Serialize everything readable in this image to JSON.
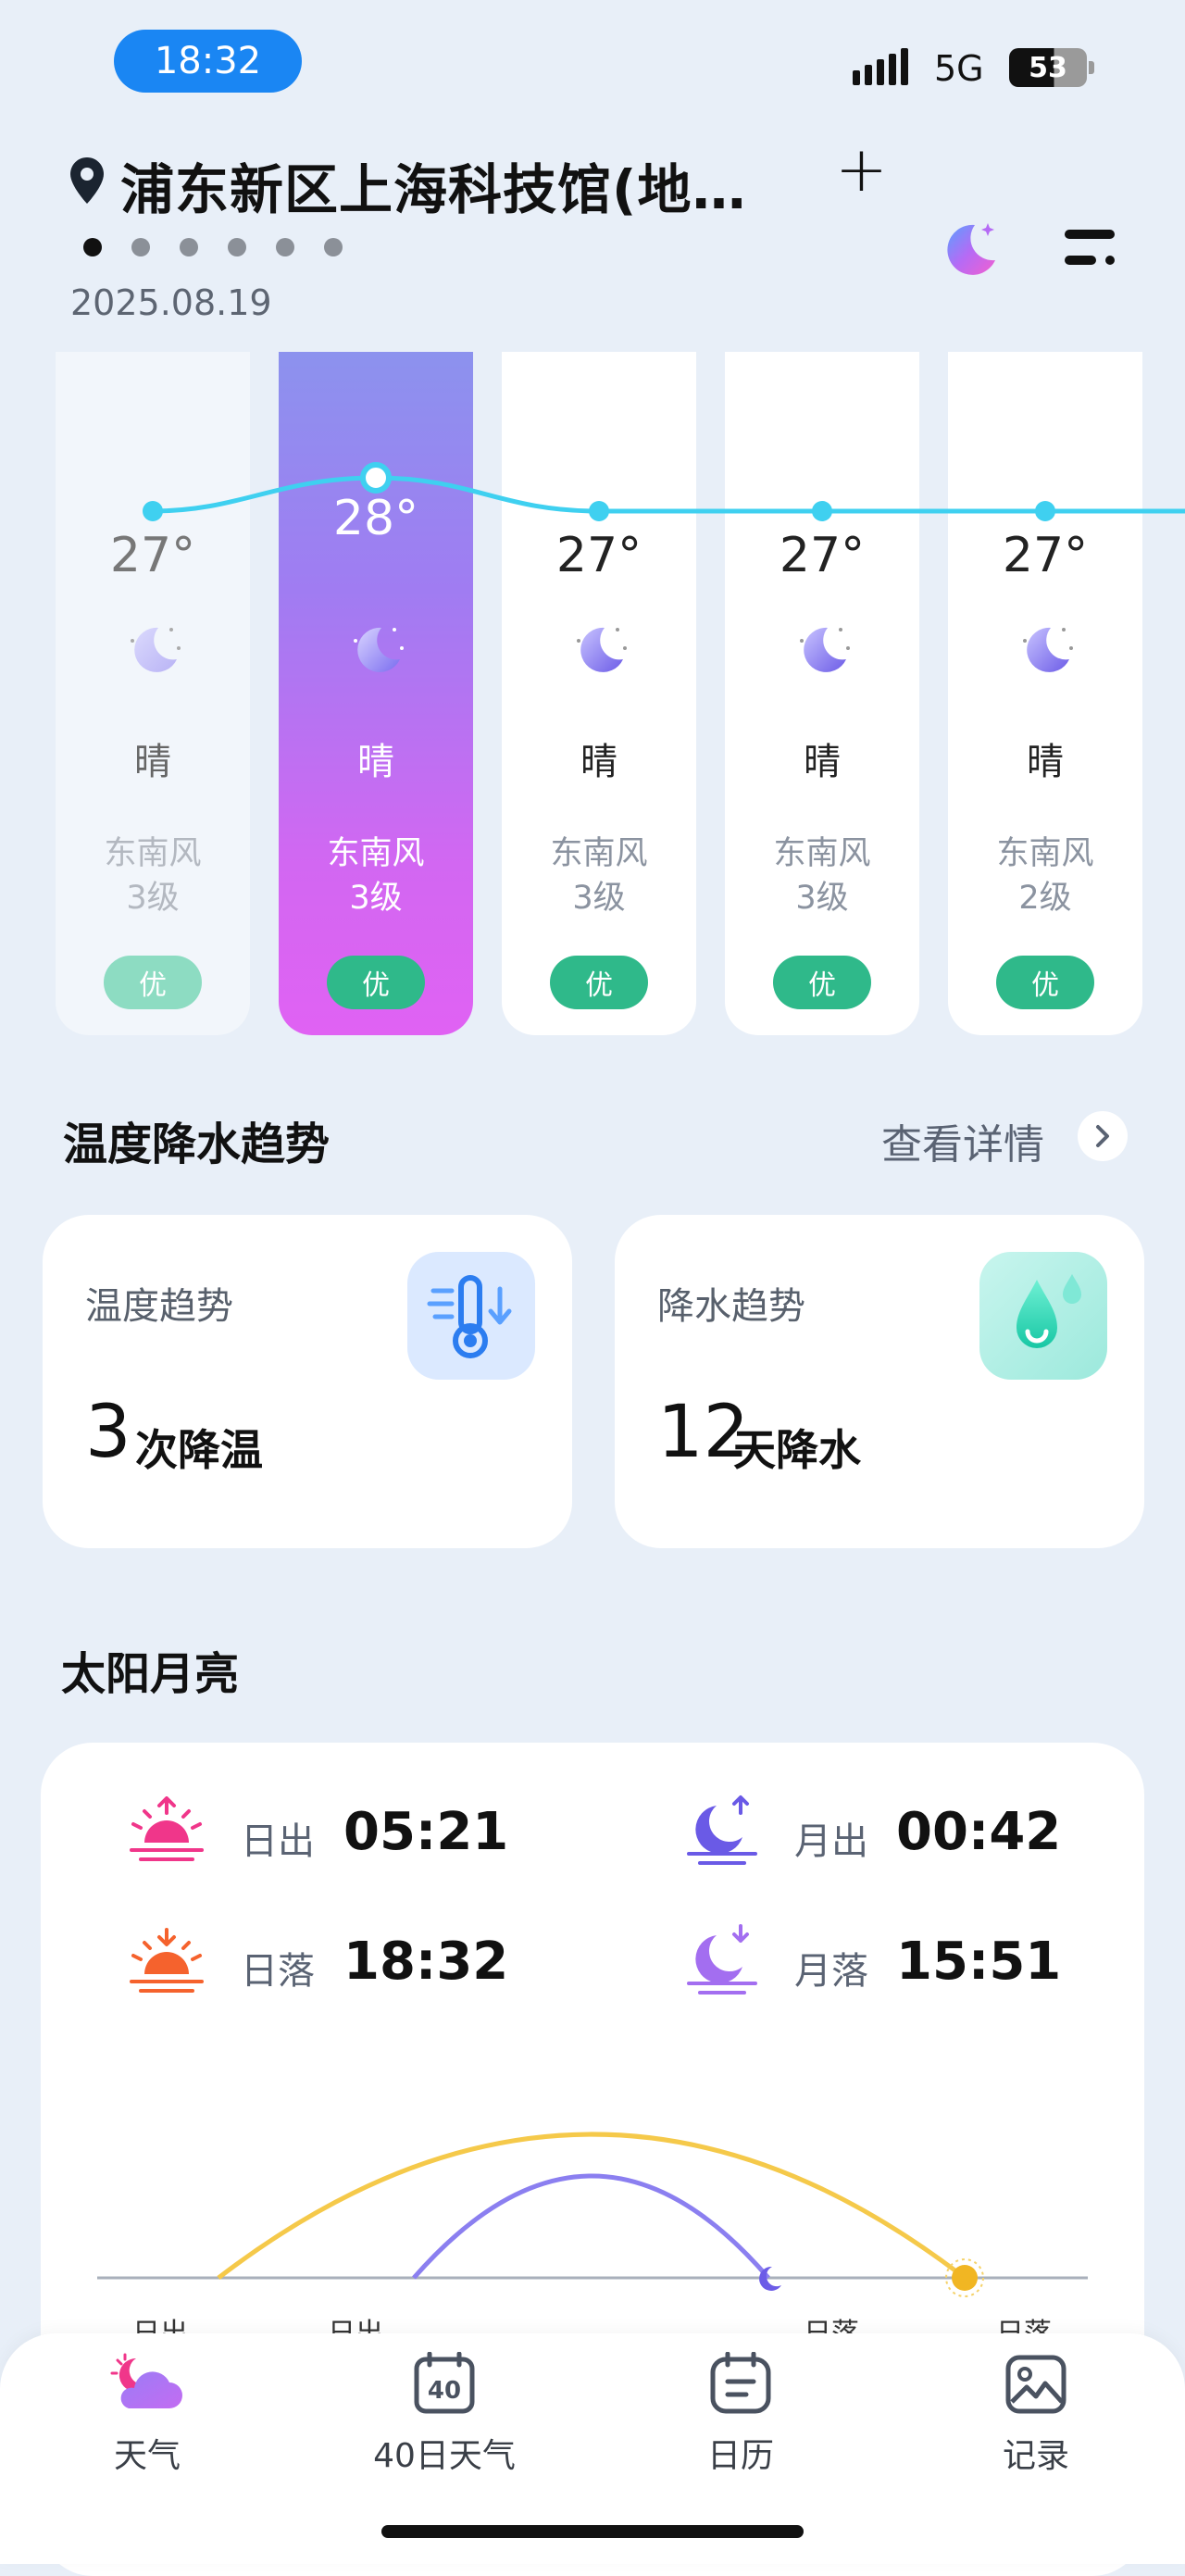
{
  "status_bar": {
    "time": "18:32",
    "network": "5G",
    "battery": "53"
  },
  "header": {
    "location": "浦东新区上海科技馆(地…",
    "add_label": "+",
    "date": "2025.08.19",
    "page_count": 6,
    "active_page": 1
  },
  "hourly": [
    {
      "temp": "27°",
      "condition": "晴",
      "wind_dir": "东南风",
      "wind_level": "3级",
      "aqi": "优",
      "state": "past"
    },
    {
      "temp": "28°",
      "condition": "晴",
      "wind_dir": "东南风",
      "wind_level": "3级",
      "aqi": "优",
      "state": "current"
    },
    {
      "temp": "27°",
      "condition": "晴",
      "wind_dir": "东南风",
      "wind_level": "3级",
      "aqi": "优",
      "state": "future"
    },
    {
      "temp": "27°",
      "condition": "晴",
      "wind_dir": "东南风",
      "wind_level": "3级",
      "aqi": "优",
      "state": "future"
    },
    {
      "temp": "27°",
      "condition": "晴",
      "wind_dir": "东南风",
      "wind_level": "2级",
      "aqi": "优",
      "state": "future"
    }
  ],
  "trend": {
    "title": "温度降水趋势",
    "detail_link": "查看详情",
    "temperature": {
      "label": "温度趋势",
      "count": "3",
      "unit": "次降温"
    },
    "precipitation": {
      "label": "降水趋势",
      "count": "12",
      "unit": "天降水"
    }
  },
  "sun_moon": {
    "title": "太阳月亮",
    "sunrise_label": "日出",
    "sunrise": "05:21",
    "sunset_label": "日落",
    "sunset": "18:32",
    "moonrise_label": "月出",
    "moonrise": "00:42",
    "moonset_label": "月落",
    "moonset": "15:51",
    "arc_labels": [
      "日出",
      "日出",
      "日落",
      "日落"
    ]
  },
  "tabs": [
    {
      "label": "天气",
      "icon": "weather-icon",
      "active": true
    },
    {
      "label": "40日天气",
      "icon": "forty-day-icon",
      "calendar_number": "40"
    },
    {
      "label": "日历",
      "icon": "calendar-icon"
    },
    {
      "label": "记录",
      "icon": "gallery-icon"
    }
  ],
  "colors": {
    "accent_blue": "#1a86f3",
    "aqi_green": "#2fb98a",
    "selected_gradient_top": "#8c92ee",
    "selected_gradient_bottom": "#e062f3",
    "sun_arc": "#f5c94a",
    "moon_arc": "#8b7ff0"
  }
}
